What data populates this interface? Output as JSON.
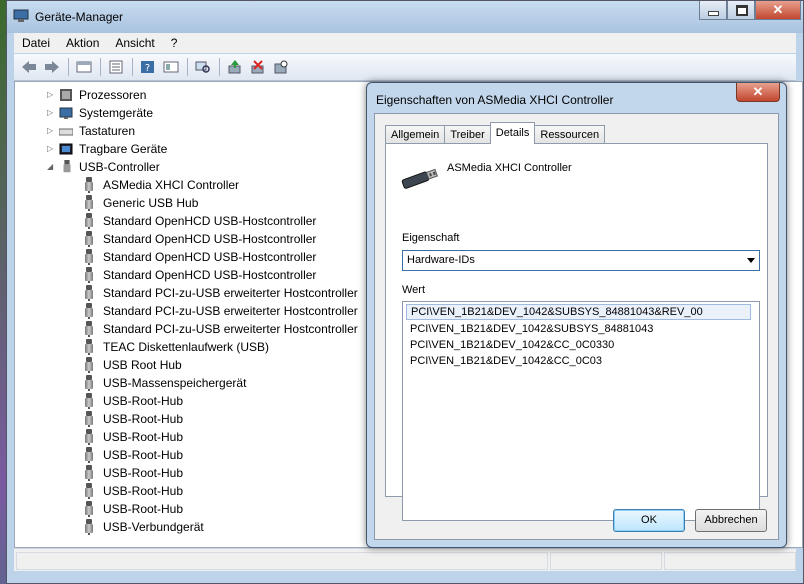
{
  "window": {
    "title": "Geräte-Manager"
  },
  "menu": [
    "Datei",
    "Aktion",
    "Ansicht",
    "?"
  ],
  "toolbar": {
    "icons": [
      "back-icon",
      "forward-icon",
      "up-icon",
      "properties-icon",
      "help-icon",
      "show-icon",
      "scan-icon",
      "update-driver-icon",
      "uninstall-icon",
      "disable-icon"
    ]
  },
  "tree": {
    "categories": [
      {
        "label": "Prozessoren",
        "expanded": false
      },
      {
        "label": "Systemgeräte",
        "expanded": false
      },
      {
        "label": "Tastaturen",
        "expanded": false
      },
      {
        "label": "Tragbare Geräte",
        "expanded": false
      },
      {
        "label": "USB-Controller",
        "expanded": true
      }
    ],
    "usb_devices": [
      "ASMedia XHCI Controller",
      "Generic USB Hub",
      "Standard OpenHCD USB-Hostcontroller",
      "Standard OpenHCD USB-Hostcontroller",
      "Standard OpenHCD USB-Hostcontroller",
      "Standard OpenHCD USB-Hostcontroller",
      "Standard PCI-zu-USB erweiterter Hostcontroller",
      "Standard PCI-zu-USB erweiterter Hostcontroller",
      "Standard PCI-zu-USB erweiterter Hostcontroller",
      "TEAC Diskettenlaufwerk (USB)",
      "USB Root Hub",
      "USB-Massenspeichergerät",
      "USB-Root-Hub",
      "USB-Root-Hub",
      "USB-Root-Hub",
      "USB-Root-Hub",
      "USB-Root-Hub",
      "USB-Root-Hub",
      "USB-Root-Hub",
      "USB-Verbundgerät"
    ]
  },
  "dialog": {
    "title": "Eigenschaften von ASMedia XHCI Controller",
    "tabs": [
      "Allgemein",
      "Treiber",
      "Details",
      "Ressourcen"
    ],
    "active_tab": "Details",
    "device_name": "ASMedia XHCI Controller",
    "property_label": "Eigenschaft",
    "property_value": "Hardware-IDs",
    "value_label": "Wert",
    "values": [
      "PCI\\VEN_1B21&DEV_1042&SUBSYS_84881043&REV_00",
      "PCI\\VEN_1B21&DEV_1042&SUBSYS_84881043",
      "PCI\\VEN_1B21&DEV_1042&CC_0C0330",
      "PCI\\VEN_1B21&DEV_1042&CC_0C03"
    ],
    "ok_label": "OK",
    "cancel_label": "Abbrechen"
  }
}
